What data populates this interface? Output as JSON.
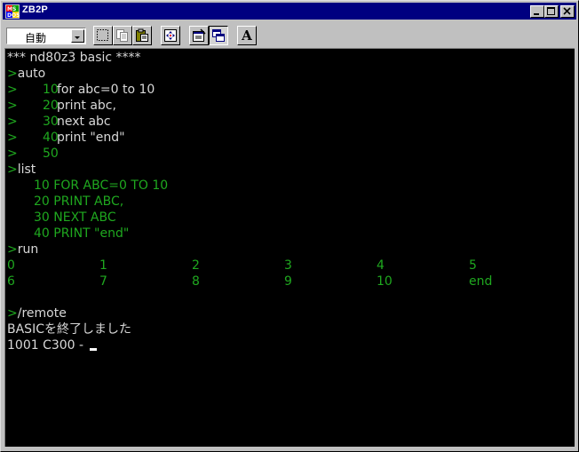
{
  "window": {
    "title": "ZB2P",
    "icon": "ms-dos-icon"
  },
  "toolbar": {
    "font_select": {
      "value": "自動"
    },
    "tools": [
      {
        "name": "mark-icon"
      },
      {
        "name": "copy-icon"
      },
      {
        "name": "paste-icon"
      },
      {
        "name": "fullscreen-icon"
      },
      {
        "name": "properties-icon"
      },
      {
        "name": "background-icon"
      },
      {
        "name": "font-icon",
        "label": "A"
      }
    ]
  },
  "terminal": {
    "banner": "*** nd80z3 basic ****",
    "prompt": ">",
    "auto_cmd": "auto",
    "auto_lines": [
      {
        "num": "10",
        "code": "for abc=0 to 10"
      },
      {
        "num": "20",
        "code": "print abc,"
      },
      {
        "num": "30",
        "code": "next abc"
      },
      {
        "num": "40",
        "code": "print \"end\""
      },
      {
        "num": "50",
        "code": ""
      }
    ],
    "list_cmd": "list",
    "list_lines": [
      "10 FOR ABC=0 TO 10",
      "20 PRINT ABC,",
      "30 NEXT ABC",
      "40 PRINT \"end\""
    ],
    "run_cmd": "run",
    "output_rows": [
      [
        "0",
        "1",
        "2",
        "3",
        "4",
        "5"
      ],
      [
        "6",
        "7",
        "8",
        "9",
        "10",
        "end"
      ]
    ],
    "remote_cmd": "/remote",
    "exit_message": "BASICを終了しました",
    "monitor_prompt": "1001 C300 - "
  },
  "colors": {
    "terminal_bg": "#000000",
    "text_white": "#d8d8d8",
    "text_green": "#1fa81f",
    "titlebar": "#000080"
  }
}
